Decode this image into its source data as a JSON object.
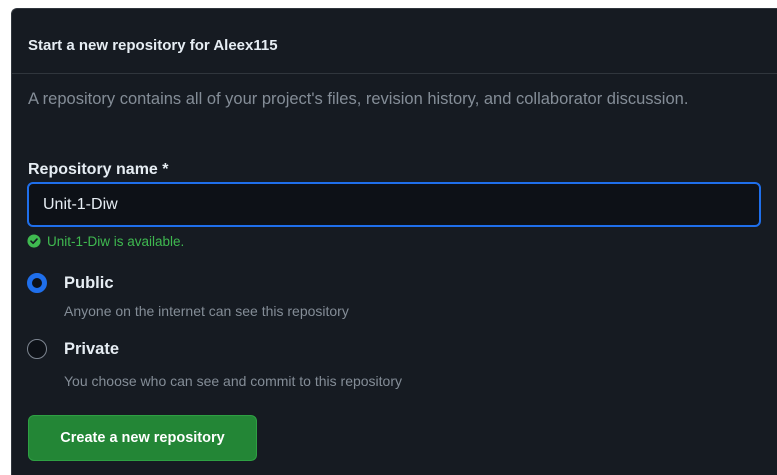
{
  "header": {
    "title": "Start a new repository for Aleex115"
  },
  "description": "A repository contains all of your project's files, revision history, and collaborator discussion.",
  "repository_name": {
    "label": "Repository name *",
    "value": "Unit-1-Diw",
    "availability_text": "Unit-1-Diw is available.",
    "status_icon": "check-circle-icon"
  },
  "visibility": {
    "selected": "Public",
    "options": [
      {
        "label": "Public",
        "description": "Anyone on the internet can see this repository",
        "checked": true
      },
      {
        "label": "Private",
        "description": "You choose who can see and commit to this repository",
        "checked": false
      }
    ]
  },
  "actions": {
    "create_label": "Create a new repository"
  },
  "colors": {
    "panel_background": "#161b22",
    "input_background": "#0d1117",
    "accent_blue": "#1f6feb",
    "success_green": "#3fb950",
    "button_green": "#238636",
    "text_primary": "#e6edf3",
    "text_muted": "#848d97"
  }
}
